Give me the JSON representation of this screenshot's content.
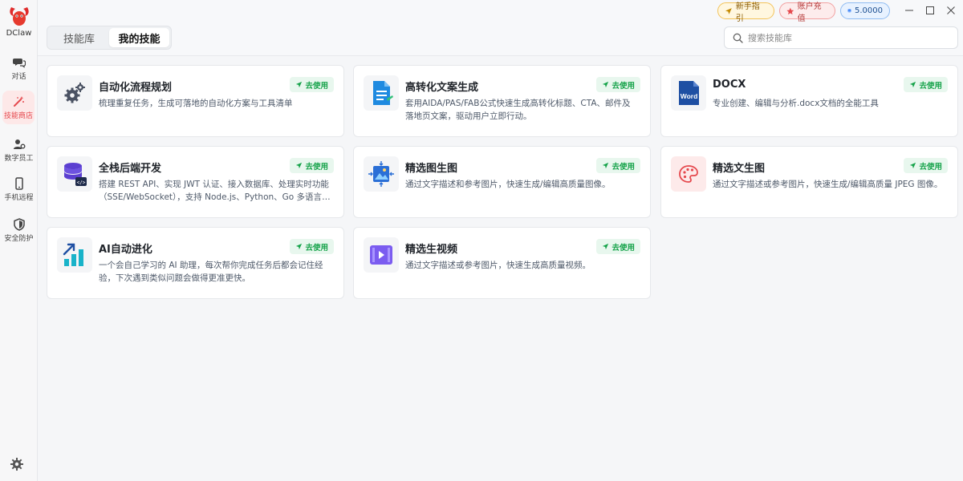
{
  "app": {
    "name": "DClaw"
  },
  "sidebar": {
    "items": [
      {
        "label": "对话",
        "icon": "chat-icon"
      },
      {
        "label": "技能商店",
        "icon": "magic-wand-icon",
        "active": true
      },
      {
        "label": "数字员工",
        "icon": "users-gear-icon"
      },
      {
        "label": "手机远程",
        "icon": "phone-icon"
      },
      {
        "label": "安全防护",
        "icon": "shield-icon"
      }
    ],
    "settings_icon": "gear-icon"
  },
  "header": {
    "tabs": [
      {
        "label": "技能库",
        "active": false
      },
      {
        "label": "我的技能",
        "active": true
      }
    ],
    "guide_label": "新手指引",
    "recharge_label": "账户充值",
    "balance": "5.0000",
    "search": {
      "placeholder": "搜索技能库",
      "value": ""
    }
  },
  "skills": [
    {
      "title": "自动化流程规划",
      "desc": "梳理重复任务，生成可落地的自动化方案与工具清单",
      "icon": "gears-icon",
      "action": "去使用"
    },
    {
      "title": "高转化文案生成",
      "desc": "套用AIDA/PAS/FAB公式快速生成高转化标题、CTA、邮件及落地页文案，驱动用户立即行动。",
      "icon": "document-edit-icon",
      "action": "去使用"
    },
    {
      "title": "DOCX",
      "desc": "专业创建、编辑与分析.docx文档的全能工具",
      "icon": "word-icon",
      "action": "去使用"
    },
    {
      "title": "全栈后端开发",
      "desc": "搭建 REST API、实现 JWT 认证、接入数据库、处理实时功能（SSE/WebSocket），支持 Node.js、Python、Go 多语言开发",
      "icon": "database-code-icon",
      "action": "去使用"
    },
    {
      "title": "精选图生图",
      "desc": "通过文字描述和参考图片，快速生成/编辑高质量图像。",
      "icon": "image-transform-icon",
      "action": "去使用"
    },
    {
      "title": "精选文生图",
      "desc": "通过文字描述或参考图片，快速生成/编辑高质量 JPEG 图像。",
      "icon": "palette-icon",
      "action": "去使用"
    },
    {
      "title": "AI自动进化",
      "desc": "一个会自己学习的 AI 助理，每次帮你完成任务后都会记住经验，下次遇到类似问题会做得更准更快。",
      "icon": "growth-chart-icon",
      "action": "去使用"
    },
    {
      "title": "精选生视频",
      "desc": "通过文字描述或参考图片，快速生成高质量视频。",
      "icon": "video-play-icon",
      "action": "去使用"
    }
  ],
  "colors": {
    "accent_red": "#e5484d",
    "use_green": "#16a34a",
    "word_blue": "#1e4fa3",
    "doc_blue": "#1f8ae0",
    "db_purple": "#5b3fd1",
    "video_purple": "#7b5cf0",
    "chart_teal": "#19b3c9"
  }
}
